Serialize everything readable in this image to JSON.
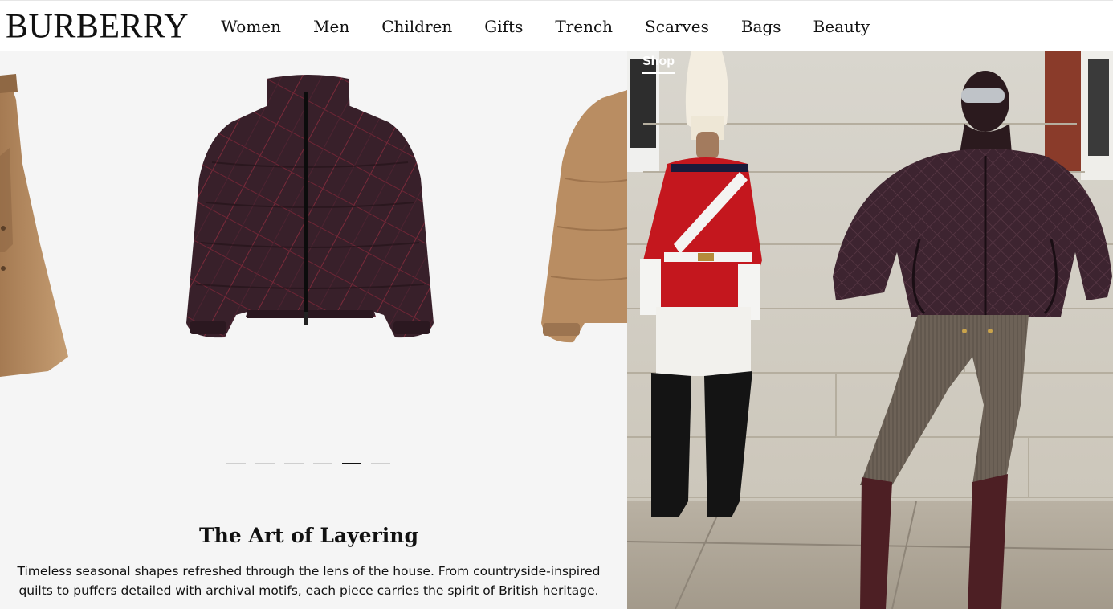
{
  "brand": {
    "logo_text": "BURBERRY"
  },
  "nav": {
    "items": [
      {
        "label": "Women"
      },
      {
        "label": "Men"
      },
      {
        "label": "Children"
      },
      {
        "label": "Gifts"
      },
      {
        "label": "Trench"
      },
      {
        "label": "Scarves"
      },
      {
        "label": "Bags"
      },
      {
        "label": "Beauty"
      }
    ]
  },
  "carousel": {
    "slide_count": 6,
    "active_index": 4
  },
  "feature": {
    "title": "The Art of Layering",
    "description": "Timeless seasonal shapes refreshed through the lens of the house. From countryside-inspired quilts to puffers detailed with archival motifs, each piece carries the spirit of British heritage."
  },
  "campaign": {
    "shop_label": "Shop"
  },
  "colors": {
    "panel_bg": "#f5f5f5",
    "puffer_burgundy": "#3a1e26",
    "camel": "#b98d62",
    "guard_red": "#c4171e"
  }
}
